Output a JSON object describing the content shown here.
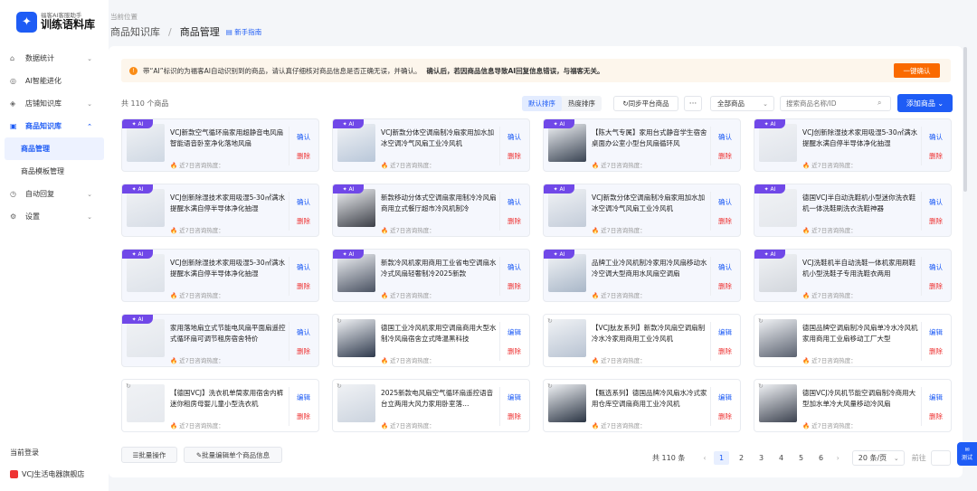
{
  "app": {
    "logo_sub": "福客AI客服助手",
    "logo_main": "训练语料库"
  },
  "sidebar": {
    "items": [
      {
        "label": "数据统计",
        "icon": "home-icon",
        "chevron": "⌄"
      },
      {
        "label": "AI智能进化",
        "icon": "ai-icon"
      },
      {
        "label": "店铺知识库",
        "icon": "shop-icon",
        "chevron": "⌄"
      },
      {
        "label": "商品知识库",
        "icon": "box-icon",
        "chevron": "⌃"
      },
      {
        "label": "自动回复",
        "icon": "reply-icon",
        "chevron": "⌄"
      },
      {
        "label": "设置",
        "icon": "settings-icon",
        "chevron": "⌄"
      }
    ],
    "sub_items": [
      {
        "label": "商品管理"
      },
      {
        "label": "商品模板管理"
      }
    ],
    "login_title": "当前登录",
    "login_shop": "VCJ生活电器旗舰店"
  },
  "breadcrumb": {
    "position_label": "当前位置",
    "root": "商品知识库",
    "current": "商品管理",
    "guide": "新手指南"
  },
  "notice": {
    "text": "带“AI”标识的为福客AI自动识别到的商品，请认真仔细核对商品信息是否正确无误，并确认。",
    "bold": "确认后，若因商品信息导致AI回复信息错误，与福客无关。",
    "button": "一键确认"
  },
  "toolbar": {
    "total": "共 110 个商品",
    "sort_default": "默认排序",
    "sort_hot": "热度排序",
    "sync": "同步平台商品",
    "more": "···",
    "filter": "全部商品",
    "search_placeholder": "搜索商品名称/ID",
    "add": "添加商品"
  },
  "card_common": {
    "heat_label": "近7日咨询热度：",
    "ai_badge": "AI",
    "confirm": "确认",
    "edit": "编辑",
    "delete": "删除"
  },
  "products": [
    {
      "title": "VCJ新款空气循环扇家用超静音电风扇智能语音卧室净化落地风扇",
      "ai": true,
      "color": "#cfd8e3"
    },
    {
      "title": "VCJ新款分体空调扇制冷扇家用加水加冰空调冷气风扇工业冷风机",
      "ai": true,
      "color": "#b9c7d9"
    },
    {
      "title": "【陈大气专属】家用台式静音学生宿舍桌面办公室小型台风扇循环风",
      "ai": true,
      "color": "#3a4453"
    },
    {
      "title": "VCJ创新除湿技术家用吸湿5-30㎡满水提醒水满自停半导体净化抽湿",
      "ai": true,
      "color": "#dfe3ea"
    },
    {
      "title": "VCJ创新除湿技术家用吸湿5-30㎡满水提醒水满自停半导体净化抽湿",
      "ai": true,
      "color": "#d7dde6"
    },
    {
      "title": "新款移动分体式空调扇家用制冷冷风扇商用立式餐厅超市冷风机制冷",
      "ai": true,
      "color": "#3c3f47"
    },
    {
      "title": "VCJ新款分体空调扇制冷扇家用加水加冰空调冷气风扇工业冷风机",
      "ai": true,
      "color": "#c3ccd9"
    },
    {
      "title": "德国VCJ半自动洗鞋机小型迷你洗衣鞋机一体洗鞋刷洗衣洗鞋神器",
      "ai": true,
      "color": "#e4e7ec"
    },
    {
      "title": "VCJ创新除湿技术家用吸湿5-30㎡满水提醒水满自停半导体净化抽湿",
      "ai": true,
      "color": "#dde2e9"
    },
    {
      "title": "新款冷风机家用商用工业省电空调扇水冷式风扇轻奢制冷2025新款",
      "ai": true,
      "color": "#4a5262"
    },
    {
      "title": "品牌工业冷风机制冷家用冷风扇移动水冷空调大型商用水风扇空调扇",
      "ai": true,
      "color": "#a9b7c8"
    },
    {
      "title": "VCJ洗鞋机半自动洗鞋一体机家用刷鞋机小型洗鞋子专用洗鞋衣两用",
      "ai": true,
      "color": "#d2d6dc"
    },
    {
      "title": "家用落地扇立式节能电风扇平面扇遥控式循环扇可调节租房宿舍特价",
      "ai": true,
      "color": "#e2e6ec"
    },
    {
      "title": "德国工业冷风机家用空调扇商用大型水制冷风扇宿舍立式降温黑科技",
      "ai": false,
      "color": "#2f3a4d"
    },
    {
      "title": "【VCJ肽友系列】新款冷风扇空调扇制冷水冷家用商用工业冷风机",
      "ai": false,
      "color": "#b8c3d2"
    },
    {
      "title": "德国品牌空调扇制冷风扇单冷水冷风机家用商用工业扇移动工厂大型",
      "ai": false,
      "color": "#5b6270"
    },
    {
      "title": "【德国VCJ】洗衣机单筒家用宿舍内裤迷你租房母婴儿童小型洗衣机",
      "ai": false,
      "color": "#e6e9ee"
    },
    {
      "title": "2025新款电风扇空气循环扇遥控语音台立两用大风力家用卧室落…",
      "ai": false,
      "color": "#cbd3de"
    },
    {
      "title": "【甄选系列】德国品牌冷风扇水冷式家用仓库空调扇商用工业冷风机",
      "ai": false,
      "color": "#2b3544"
    },
    {
      "title": "德国VCJ冷风机节能空调扇制冷商用大型加水单冷大风量移动冷风扇",
      "ai": false,
      "color": "#3d4350"
    }
  ],
  "bottom": {
    "batch": "批量操作",
    "batch_edit": "批量编辑单个商品信息"
  },
  "pagination": {
    "total": "共 110 条",
    "pages": [
      "1",
      "2",
      "3",
      "4",
      "5",
      "6"
    ],
    "current": "1",
    "size": "20 条/页",
    "goto": "前往"
  },
  "chat_fab": "测试"
}
